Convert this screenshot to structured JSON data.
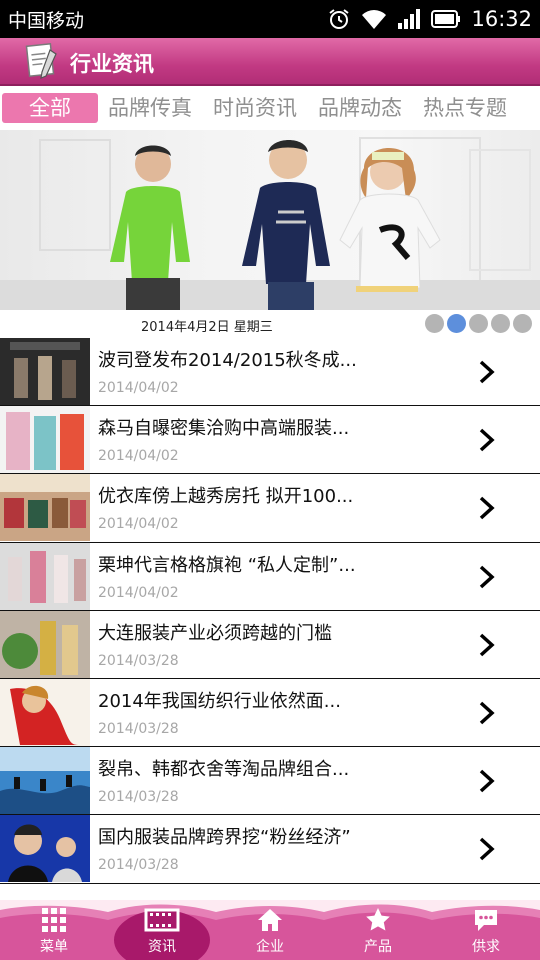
{
  "status_bar": {
    "carrier": "中国移动",
    "time": "16:32"
  },
  "header": {
    "title": "行业资讯"
  },
  "tabs": [
    {
      "label": "全部",
      "active": true
    },
    {
      "label": "品牌传真",
      "active": false
    },
    {
      "label": "时尚资讯",
      "active": false
    },
    {
      "label": "品牌动态",
      "active": false
    },
    {
      "label": "热点专题",
      "active": false
    }
  ],
  "banner": {
    "date": "2014年4月2日  星期三",
    "page_count": 5,
    "active_page": 2
  },
  "news": [
    {
      "title": "波司登发布2014/2015秋冬成...",
      "date": "2014/04/02"
    },
    {
      "title": "森马自曝密集洽购中高端服装...",
      "date": "2014/04/02"
    },
    {
      "title": "优衣库傍上越秀房托 拟开100...",
      "date": "2014/04/02"
    },
    {
      "title": "栗坤代言格格旗袍 “私人定制”...",
      "date": "2014/04/02"
    },
    {
      "title": "大连服装产业必须跨越的门槛",
      "date": "2014/03/28"
    },
    {
      "title": "2014年我国纺织行业依然面...",
      "date": "2014/03/28"
    },
    {
      "title": "裂帛、韩都衣舍等淘品牌组合...",
      "date": "2014/03/28"
    },
    {
      "title": "国内服装品牌跨界挖“粉丝经济”",
      "date": "2014/03/28"
    }
  ],
  "bottom_nav": [
    {
      "label": "菜单",
      "icon": "grid-icon"
    },
    {
      "label": "资讯",
      "icon": "film-icon",
      "active": true
    },
    {
      "label": "企业",
      "icon": "home-icon"
    },
    {
      "label": "产品",
      "icon": "star-icon"
    },
    {
      "label": "供求",
      "icon": "chat-icon"
    }
  ]
}
